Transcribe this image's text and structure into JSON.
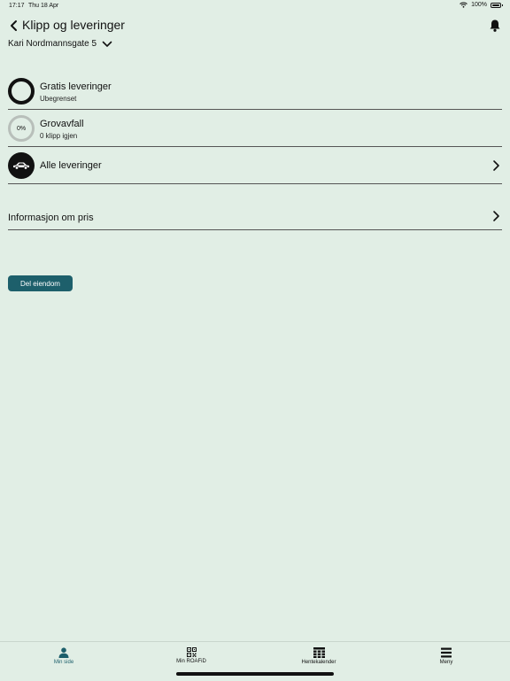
{
  "status_bar": {
    "time": "17:17",
    "date": "Thu 18 Apr",
    "battery": "100%"
  },
  "header": {
    "title": "Klipp og leveringer"
  },
  "address": {
    "label": "Kari Nordmannsgate 5"
  },
  "rows": [
    {
      "title": "Gratis leveringer",
      "subtitle": "Ubegrenset"
    },
    {
      "title": "Grovavfall",
      "subtitle": "0 klipp igjen",
      "percent_label": "0%"
    },
    {
      "title": "Alle leveringer"
    }
  ],
  "info": {
    "title": "Informasjon om pris"
  },
  "share_button": {
    "label": "Del eiendom"
  },
  "tabs": [
    {
      "label": "Min side",
      "icon": "person-icon",
      "active": true
    },
    {
      "label": "Min ROAFiD",
      "icon": "qr-code-icon",
      "active": false
    },
    {
      "label": "Hentekalender",
      "icon": "calendar-grid-icon",
      "active": false
    },
    {
      "label": "Meny",
      "icon": "menu-icon",
      "active": false
    }
  ],
  "colors": {
    "background": "#e1eee5",
    "accent": "#1d5f6b",
    "text": "#111111"
  }
}
